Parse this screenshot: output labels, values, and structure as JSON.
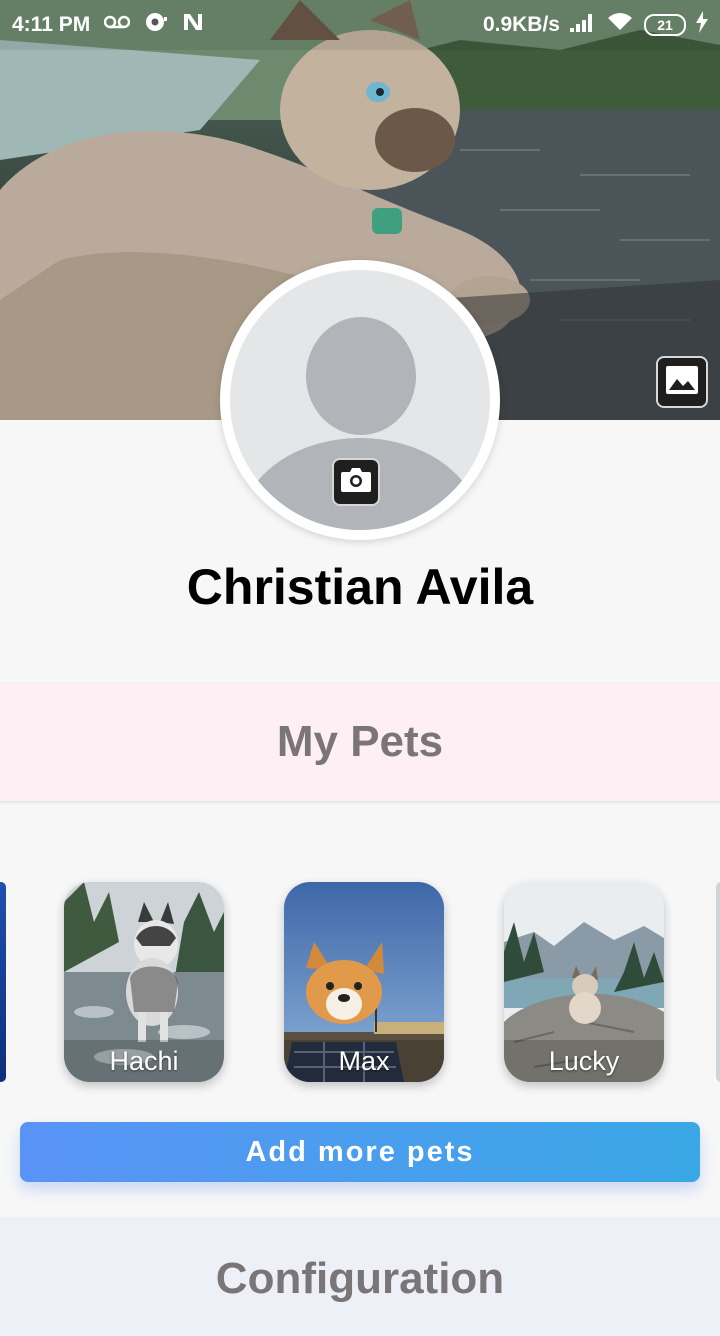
{
  "status_bar": {
    "time": "4:11 PM",
    "network_speed": "0.9KB/s",
    "battery": "21",
    "icons": [
      "voicemail-icon",
      "alarm-icon",
      "nfc-icon",
      "signal-icon",
      "wifi-icon",
      "battery-icon",
      "charging-icon"
    ]
  },
  "profile": {
    "name": "Christian Avila",
    "cover_button_icon": "image-icon",
    "avatar_button_icon": "camera-icon"
  },
  "pets_section": {
    "title": "My Pets",
    "pets": [
      {
        "name": "Hachi"
      },
      {
        "name": "Max"
      },
      {
        "name": "Lucky"
      }
    ],
    "add_button_label": "Add more pets"
  },
  "config_section": {
    "title": "Configuration"
  },
  "colors": {
    "pets_header_bg": "#fdeff4",
    "config_header_bg": "#eef0f8",
    "button_gradient_start": "#5a93f6",
    "button_gradient_end": "#3aa8e6"
  }
}
